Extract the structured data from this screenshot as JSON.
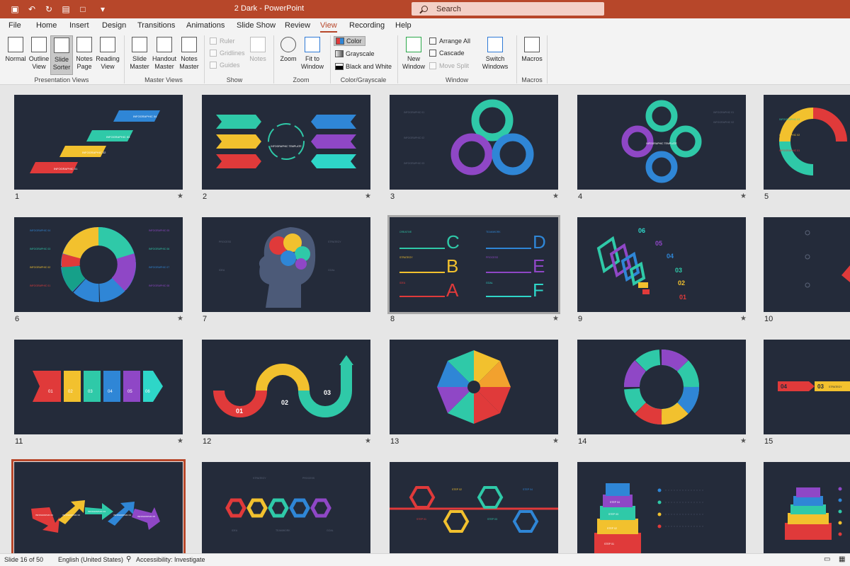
{
  "app": {
    "title": "2 Dark  -  PowerPoint",
    "search_placeholder": "Search"
  },
  "tabs": [
    "File",
    "Home",
    "Insert",
    "Design",
    "Transitions",
    "Animations",
    "Slide Show",
    "Review",
    "View",
    "Recording",
    "Help"
  ],
  "active_tab": "View",
  "ribbon": {
    "presentation_views": {
      "label": "Presentation Views",
      "buttons": [
        "Normal",
        "Outline View",
        "Slide Sorter",
        "Notes Page",
        "Reading View"
      ],
      "selected": "Slide Sorter"
    },
    "master_views": {
      "label": "Master Views",
      "buttons": [
        "Slide Master",
        "Handout Master",
        "Notes Master"
      ]
    },
    "show": {
      "label": "Show",
      "checks": [
        "Ruler",
        "Gridlines",
        "Guides"
      ],
      "notes": "Notes"
    },
    "zoom": {
      "label": "Zoom",
      "buttons": [
        "Zoom",
        "Fit to Window"
      ]
    },
    "color": {
      "label": "Color/Grayscale",
      "items": [
        "Color",
        "Grayscale",
        "Black and White"
      ]
    },
    "window": {
      "label": "Window",
      "new_window": "New Window",
      "arrange_all": "Arrange All",
      "cascade": "Cascade",
      "move_split": "Move Split",
      "switch_windows": "Switch Windows"
    },
    "macros": {
      "label": "Macros",
      "button": "Macros"
    }
  },
  "slides": [
    {
      "num": "1",
      "texts": [
        "INFOGRAPHIC 04",
        "INFOGRAPHIC 03",
        "INFOGRAPHIC 02",
        "INFOGRAPHIC 01"
      ]
    },
    {
      "num": "2",
      "texts": [
        "INFOGRAPHIC TEMPLATE"
      ]
    },
    {
      "num": "3",
      "texts": [
        "INFOGRAPHIC 01",
        "INFOGRAPHIC 02",
        "INFOGRAPHIC 03"
      ]
    },
    {
      "num": "4",
      "texts": [
        "INFOGRAPHIC 01",
        "INFOGRAPHIC 02",
        "INFOGRAPHIC TEMPLATE"
      ]
    },
    {
      "num": "5",
      "texts": [
        "INFOGRAPHIC 03",
        "INFOGRAPHIC 02",
        "INFOGRAPHIC 01"
      ]
    },
    {
      "num": "6",
      "texts": [
        "INFOGRAPHIC 04",
        "INFOGRAPHIC 03",
        "INFOGRAPHIC 02",
        "INFOGRAPHIC 01",
        "INFOGRAPHIC 05",
        "INFOGRAPHIC 06",
        "INFOGRAPHIC 07",
        "INFOGRAPHIC 08"
      ]
    },
    {
      "num": "7",
      "texts": [
        "PROCESS",
        "IDEA",
        "STRATEGY",
        "GOAL"
      ]
    },
    {
      "num": "8",
      "texts": [
        "CREATIVE",
        "STRATEGY",
        "IDEA",
        "TEAMWORK",
        "PROCESS",
        "GOAL",
        "C",
        "B",
        "A",
        "D",
        "E",
        "F"
      ]
    },
    {
      "num": "9",
      "texts": [
        "06",
        "05",
        "04",
        "03",
        "02",
        "01"
      ]
    },
    {
      "num": "10",
      "texts": []
    },
    {
      "num": "11",
      "texts": [
        "01",
        "02",
        "03",
        "04",
        "05",
        "06"
      ]
    },
    {
      "num": "12",
      "texts": [
        "01",
        "02",
        "03"
      ]
    },
    {
      "num": "13",
      "texts": []
    },
    {
      "num": "14",
      "texts": []
    },
    {
      "num": "15",
      "texts": [
        "04",
        "03",
        "STRATEGY"
      ]
    },
    {
      "num": "16",
      "texts": [
        "INFOGRAPHIC 01",
        "INFOGRAPHIC 02",
        "INFOGRAPHIC 03",
        "INFOGRAPHIC 04",
        "INFOGRAPHIC 05"
      ]
    },
    {
      "num": "17",
      "texts": [
        "STRATEGY",
        "PROCESS",
        "IDEA",
        "TEAMWORK",
        "GOAL"
      ]
    },
    {
      "num": "18",
      "texts": [
        "STEP 02",
        "STEP 04",
        "STEP 01",
        "STEP 03"
      ]
    },
    {
      "num": "19",
      "texts": [
        "STEP 04",
        "STEP 03",
        "STEP 02",
        "STEP 01"
      ]
    },
    {
      "num": "20",
      "texts": []
    }
  ],
  "status": {
    "slide": "Slide 16 of 50",
    "language": "English (United States)",
    "accessibility": "Accessibility: Investigate"
  },
  "colors": {
    "accent": "#b7472a",
    "slide_bg": "#242b3a",
    "red": "#e03a3a",
    "yellow": "#f2c12e",
    "teal": "#2fc9a8",
    "blue": "#2f86d6",
    "purple": "#8f47c6",
    "cyan": "#2ed6c8"
  }
}
